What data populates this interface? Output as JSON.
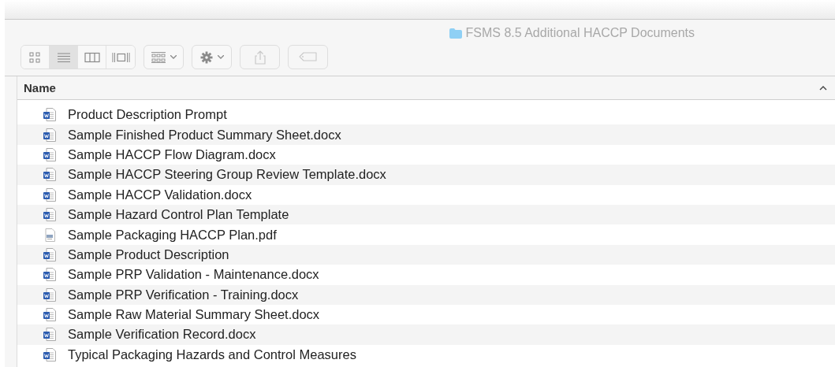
{
  "window": {
    "title": "FSMS 8.5 Additional HACCP Documents"
  },
  "toolbar": {
    "view_modes": [
      {
        "kind": "icons",
        "selected": false
      },
      {
        "kind": "list",
        "selected": true
      },
      {
        "kind": "columns",
        "selected": false
      },
      {
        "kind": "gallery",
        "selected": false
      }
    ],
    "buttons": [
      {
        "kind": "arrange",
        "disabled": false
      },
      {
        "kind": "action",
        "disabled": false
      },
      {
        "kind": "share",
        "disabled": true
      },
      {
        "kind": "tags",
        "disabled": true
      }
    ]
  },
  "table": {
    "columns": [
      {
        "label": "Name",
        "sort_ascending": true
      }
    ],
    "rows": [
      {
        "name": "Product Description Prompt",
        "kind": "word"
      },
      {
        "name": "Sample Finished Product Summary Sheet.docx",
        "kind": "word"
      },
      {
        "name": "Sample HACCP Flow Diagram.docx",
        "kind": "word"
      },
      {
        "name": "Sample HACCP Steering Group Review Template.docx",
        "kind": "word"
      },
      {
        "name": "Sample HACCP Validation.docx",
        "kind": "word"
      },
      {
        "name": "Sample Hazard Control Plan Template",
        "kind": "word"
      },
      {
        "name": "Sample Packaging HACCP Plan.pdf",
        "kind": "pdf"
      },
      {
        "name": "Sample Product Description",
        "kind": "word"
      },
      {
        "name": "Sample PRP Validation - Maintenance.docx",
        "kind": "word"
      },
      {
        "name": "Sample PRP Verification - Training.docx",
        "kind": "word"
      },
      {
        "name": "Sample Raw Material Summary Sheet.docx",
        "kind": "word"
      },
      {
        "name": "Sample Verification Record.docx",
        "kind": "word"
      },
      {
        "name": "Typical Packaging Hazards and Control Measures",
        "kind": "word"
      }
    ]
  }
}
